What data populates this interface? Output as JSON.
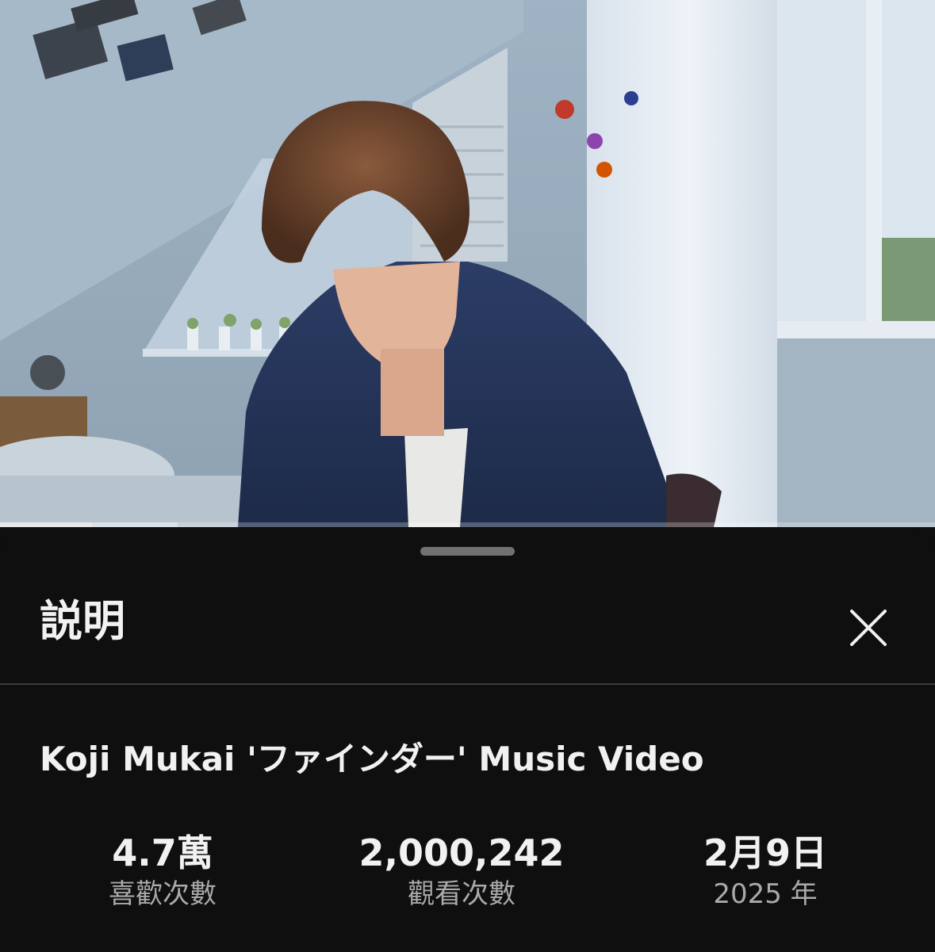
{
  "video": {
    "thumbnail_icon": "video-frame-image",
    "progress_fraction": 0.098,
    "buffered_fraction": 0.19
  },
  "sheet": {
    "title": "説明",
    "close_icon": "close-icon",
    "video_title": "Koji Mukai 'ファインダー' Music Video",
    "stats": {
      "likes": {
        "value": "4.7萬",
        "label": "喜歡次數"
      },
      "views": {
        "value": "2,000,242",
        "label": "觀看次數"
      },
      "date": {
        "value": "2月9日",
        "label": "2025 年"
      }
    }
  },
  "colors": {
    "background": "#0f0f0f",
    "text_primary": "#f1f1f1",
    "text_secondary": "#aaaaaa",
    "progress": "#e8e8e8"
  }
}
